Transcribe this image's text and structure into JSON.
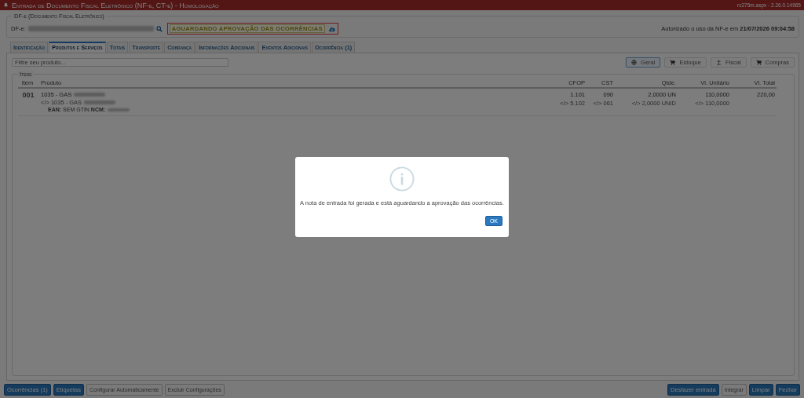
{
  "window": {
    "title": "Entrada de Documento Fiscal Eletrônico (NF-e, CT-e) - Homologação",
    "version": "rc275m.aspx - 2.26.0.14965"
  },
  "dfe": {
    "legend": "DF-e (Documento Fiscal Eletrônico)",
    "label": "DF-e:",
    "status": "AGUARDANDO APROVAÇÃO DAS OCORRÊNCIAS",
    "authorization": "Autorizado o uso da NF-e em **21/07/2026 09:04:58**"
  },
  "tabs": [
    {
      "label": "Identificação",
      "selected": false
    },
    {
      "label": "Produtos e Serviços",
      "selected": true
    },
    {
      "label": "Totais",
      "selected": false
    },
    {
      "label": "Transporte",
      "selected": false
    },
    {
      "label": "Cobrança",
      "selected": false
    },
    {
      "label": "Informações Adicionais",
      "selected": false
    },
    {
      "label": "Eventos Adicionais",
      "selected": false
    },
    {
      "label": "Ocorrência (1)",
      "selected": false
    }
  ],
  "filter": {
    "placeholder": "Filtre seu produto..."
  },
  "views": [
    {
      "label": "Geral",
      "kind": "globe",
      "selected": true
    },
    {
      "label": "Estoque",
      "kind": "cart",
      "selected": false
    },
    {
      "label": "Fiscal",
      "kind": "scale",
      "selected": false
    },
    {
      "label": "Compras",
      "kind": "cart",
      "selected": false
    }
  ],
  "items": {
    "legend": "Itens",
    "columns": [
      "Item",
      "Produto",
      "CFOP",
      "CST",
      "Qtde.",
      "Vl. Unitário",
      "Vl. Total"
    ],
    "rows": [
      {
        "item": "001",
        "product": "1035 - GAS",
        "product_xml": "</> 1035 - GAS",
        "details": "**EAN:** SEM GTIN **NCM:**",
        "cfop": "1.101",
        "cfop_xml": "</> 5.102",
        "cst": "090",
        "cst_xml": "</> 061",
        "qty": "2,0000 UN",
        "qty_xml": "</> 2,0000 UNID",
        "unit": "110,0000",
        "unit_xml": "</> 110,0000",
        "total": "220,00"
      }
    ]
  },
  "buttons_left": [
    {
      "label": "Ocorrências (1)",
      "disabled": false
    },
    {
      "label": "Etiquetas",
      "disabled": false
    },
    {
      "label": "Configurar Automaticamente",
      "disabled": true
    },
    {
      "label": "Excluir Configurações",
      "disabled": true
    }
  ],
  "buttons_right": [
    {
      "label": "Desfazer entrada",
      "disabled": false
    },
    {
      "label": "Integrar",
      "disabled": true
    },
    {
      "label": "Limpar",
      "disabled": false
    },
    {
      "label": "Fechar",
      "disabled": false
    }
  ],
  "dialog": {
    "message": "A nota de entrada foi gerada e está aguardando a aprovação das ocorrências.",
    "button": "OK"
  }
}
